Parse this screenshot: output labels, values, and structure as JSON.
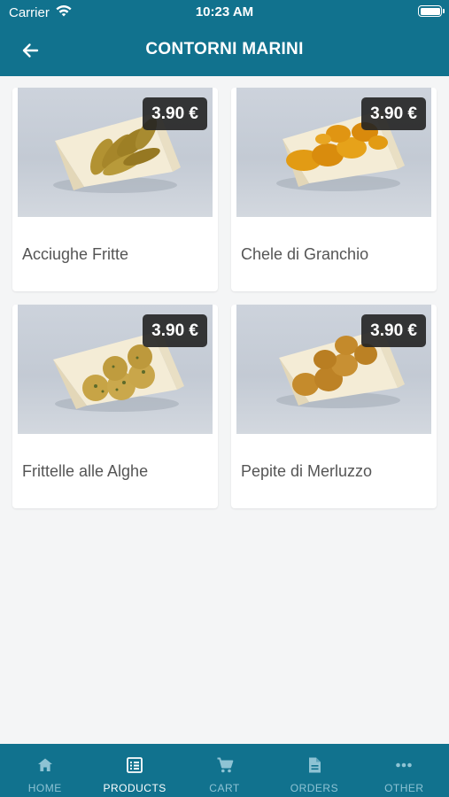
{
  "status_bar": {
    "carrier": "Carrier",
    "time": "10:23 AM"
  },
  "header": {
    "title": "CONTORNI MARINI",
    "back_icon": "arrow-left-icon"
  },
  "products": [
    {
      "name": "Acciughe Fritte",
      "price": "3.90 €"
    },
    {
      "name": "Chele di Granchio",
      "price": "3.90 €"
    },
    {
      "name": "Frittelle alle Alghe",
      "price": "3.90 €"
    },
    {
      "name": "Pepite di Merluzzo",
      "price": "3.90 €"
    }
  ],
  "tabs": [
    {
      "label": "HOME",
      "icon": "home-icon",
      "active": false
    },
    {
      "label": "PRODUCTS",
      "icon": "list-icon",
      "active": true
    },
    {
      "label": "CART",
      "icon": "cart-icon",
      "active": false
    },
    {
      "label": "ORDERS",
      "icon": "document-icon",
      "active": false
    },
    {
      "label": "OTHER",
      "icon": "more-icon",
      "active": false
    }
  ],
  "colors": {
    "primary": "#11728e",
    "badge": "#222222",
    "background": "#f4f5f6"
  }
}
